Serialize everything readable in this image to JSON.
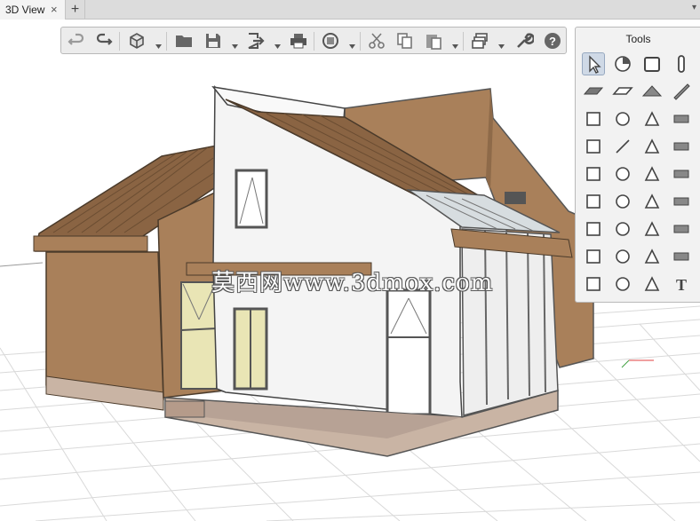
{
  "tab": {
    "label": "3D View",
    "close_glyph": "×",
    "add_glyph": "+",
    "menu_glyph": "▾"
  },
  "toolbar": {
    "buttons": [
      "undo-icon",
      "redo-icon",
      "view-cube-icon",
      "open-folder-icon",
      "save-icon",
      "export-icon",
      "print-icon",
      "rotate-view-icon",
      "cut-icon",
      "copy-icon",
      "paste-icon",
      "layers-icon",
      "settings-wrench-icon",
      "help-icon"
    ]
  },
  "tools": {
    "title": "Tools",
    "items": [
      "select-pointer-icon",
      "material-icon",
      "wall-icon",
      "column-icon",
      "slab-icon",
      "floor-icon",
      "roof-icon",
      "beam-icon",
      "stair-icon",
      "ramp-icon",
      "door-icon",
      "window-icon",
      "table-icon",
      "line-icon",
      "furniture-icon",
      "cabinet-icon",
      "toilet-icon",
      "washer-icon",
      "plant-icon",
      "pipe-icon",
      "plumbing-icon",
      "electrical-icon",
      "fan-icon",
      "duct-icon",
      "fixture-icon",
      "lamp-icon",
      "switch-icon",
      "outlet-icon",
      "appliance-icon",
      "sphere-icon",
      "camera-icon",
      "socket-icon",
      "dimension-icon",
      "spline-icon",
      "hatch-icon",
      "text-icon"
    ]
  },
  "watermark": {
    "text": "莫西网www.3dmox.com"
  },
  "colors": {
    "wood": "#a9805a",
    "wall": "#f4f4f4",
    "roof": "#8a6443",
    "grid": "#d6d6d6",
    "glass": "#e9e5b5"
  }
}
